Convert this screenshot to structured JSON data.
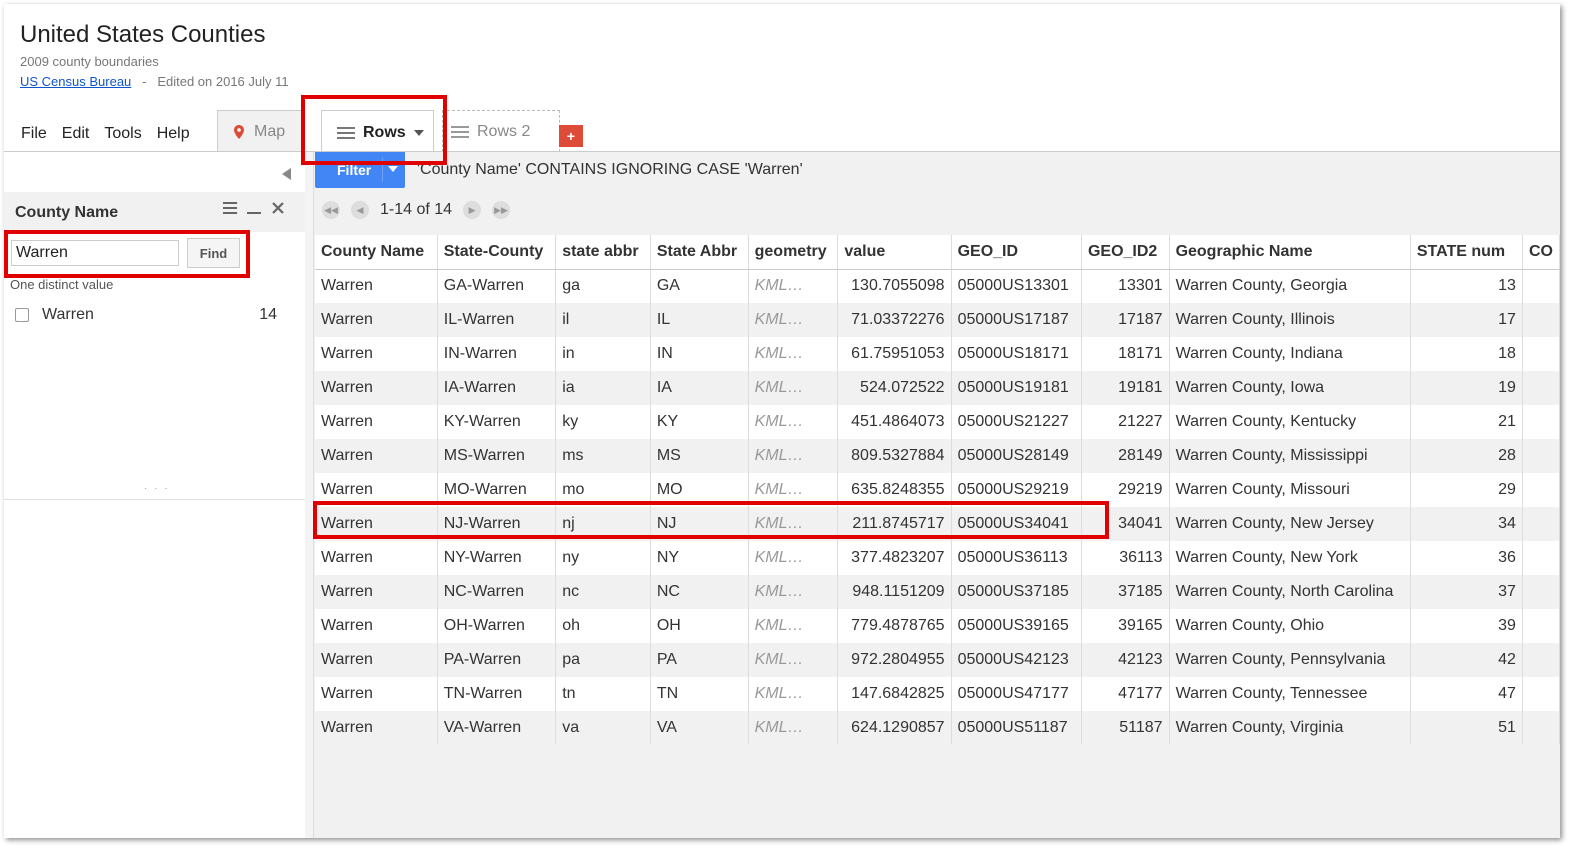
{
  "header": {
    "title": "United States Counties",
    "subtitle": "2009 county boundaries",
    "source_link": "US Census Bureau",
    "separator": "-",
    "edited": "Edited on 2016 July 11"
  },
  "menu": [
    "File",
    "Edit",
    "Tools",
    "Help"
  ],
  "tabs": {
    "map": "Map",
    "rows": "Rows",
    "rows2": "Rows 2",
    "add": "+"
  },
  "filter_panel": {
    "column_label": "County Name",
    "search_value": "Warren",
    "find_label": "Find",
    "distinct_label": "One distinct value",
    "facet": {
      "label": "Warren",
      "count": "14"
    },
    "grip": "· · ·"
  },
  "filter_bar": {
    "button_label": "Filter",
    "expression": "'County Name' CONTAINS IGNORING CASE 'Warren'"
  },
  "pager": {
    "range": "1-14 of 14"
  },
  "table": {
    "columns": [
      "County Name",
      "State-County",
      "state abbr",
      "State Abbr",
      "geometry",
      "value",
      "GEO_ID",
      "GEO_ID2",
      "Geographic Name",
      "STATE num",
      "CO"
    ],
    "rows": [
      [
        "Warren",
        "GA-Warren",
        "ga",
        "GA",
        "KML…",
        "130.7055098",
        "05000US13301",
        "13301",
        "Warren County, Georgia",
        "13",
        ""
      ],
      [
        "Warren",
        "IL-Warren",
        "il",
        "IL",
        "KML…",
        "71.03372276",
        "05000US17187",
        "17187",
        "Warren County, Illinois",
        "17",
        ""
      ],
      [
        "Warren",
        "IN-Warren",
        "in",
        "IN",
        "KML…",
        "61.75951053",
        "05000US18171",
        "18171",
        "Warren County, Indiana",
        "18",
        ""
      ],
      [
        "Warren",
        "IA-Warren",
        "ia",
        "IA",
        "KML…",
        "524.072522",
        "05000US19181",
        "19181",
        "Warren County, Iowa",
        "19",
        ""
      ],
      [
        "Warren",
        "KY-Warren",
        "ky",
        "KY",
        "KML…",
        "451.4864073",
        "05000US21227",
        "21227",
        "Warren County, Kentucky",
        "21",
        ""
      ],
      [
        "Warren",
        "MS-Warren",
        "ms",
        "MS",
        "KML…",
        "809.5327884",
        "05000US28149",
        "28149",
        "Warren County, Mississippi",
        "28",
        ""
      ],
      [
        "Warren",
        "MO-Warren",
        "mo",
        "MO",
        "KML…",
        "635.8248355",
        "05000US29219",
        "29219",
        "Warren County, Missouri",
        "29",
        ""
      ],
      [
        "Warren",
        "NJ-Warren",
        "nj",
        "NJ",
        "KML…",
        "211.8745717",
        "05000US34041",
        "34041",
        "Warren County, New Jersey",
        "34",
        ""
      ],
      [
        "Warren",
        "NY-Warren",
        "ny",
        "NY",
        "KML…",
        "377.4823207",
        "05000US36113",
        "36113",
        "Warren County, New York",
        "36",
        ""
      ],
      [
        "Warren",
        "NC-Warren",
        "nc",
        "NC",
        "KML…",
        "948.1151209",
        "05000US37185",
        "37185",
        "Warren County, North Carolina",
        "37",
        ""
      ],
      [
        "Warren",
        "OH-Warren",
        "oh",
        "OH",
        "KML…",
        "779.4878765",
        "05000US39165",
        "39165",
        "Warren County, Ohio",
        "39",
        ""
      ],
      [
        "Warren",
        "PA-Warren",
        "pa",
        "PA",
        "KML…",
        "972.2804955",
        "05000US42123",
        "42123",
        "Warren County, Pennsylvania",
        "42",
        ""
      ],
      [
        "Warren",
        "TN-Warren",
        "tn",
        "TN",
        "KML…",
        "147.6842825",
        "05000US47177",
        "47177",
        "Warren County, Tennessee",
        "47",
        ""
      ],
      [
        "Warren",
        "VA-Warren",
        "va",
        "VA",
        "KML…",
        "624.1290857",
        "05000US51187",
        "51187",
        "Warren County, Virginia",
        "51",
        ""
      ]
    ]
  },
  "colors": {
    "highlight": "#e00000",
    "filter_button": "#4285f4",
    "add_tab": "#dd4b39",
    "link": "#1155cc"
  }
}
